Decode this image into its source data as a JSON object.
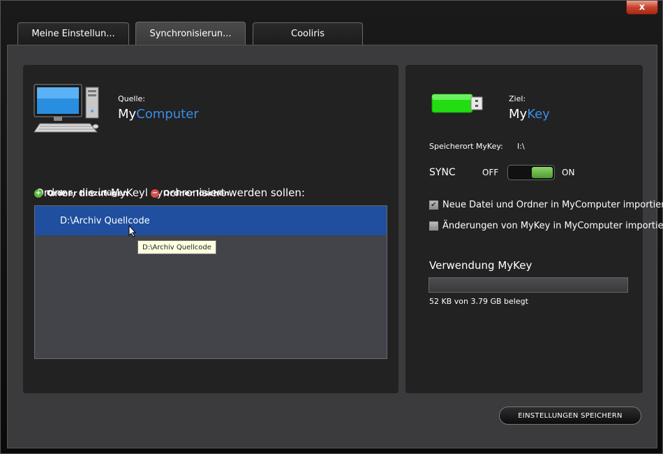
{
  "window": {
    "close_glyph": "x"
  },
  "tabs": [
    {
      "label": "Meine Einstellun..."
    },
    {
      "label": "Synchronisierun...",
      "active": true
    },
    {
      "label": "Cooliris"
    }
  ],
  "source": {
    "caption": "Quelle:",
    "name_prefix": "My",
    "name_accent": "Computer",
    "icon": "desktop-computer-icon"
  },
  "folders": {
    "heading": "Ordner, die in MyKeyl synchronisiert werden sollen:",
    "add_label": "Ordner hinzufügen",
    "remove_label": "Ordner löschen",
    "items": [
      "D:\\Archiv Quellcode"
    ],
    "tooltip": "D:\\Archiv Quellcode"
  },
  "target": {
    "caption": "Ziel:",
    "name_prefix": "My",
    "name_accent": "Key",
    "icon": "usb-stick-icon",
    "location_label": "Speicherort MyKey:",
    "location_value": "I:\\"
  },
  "sync": {
    "label": "SYNC",
    "off_label": "OFF",
    "on_label": "ON",
    "state": "on"
  },
  "options": [
    {
      "label": "Neue Datei und Ordner in MyComputer importieren",
      "checked": true
    },
    {
      "label": "Änderungen von MyKey in MyComputer importieren",
      "checked": false
    }
  ],
  "usage": {
    "title": "Verwendung MyKey",
    "text": "52 KB von 3.79 GB belegt",
    "fraction": 0.0
  },
  "footer": {
    "save_label": "EINSTELLUNGEN SPEICHERN"
  },
  "colors": {
    "accent": "#3a8ee6",
    "selection": "#1f4f9e",
    "usb_green": "#22dd11"
  }
}
